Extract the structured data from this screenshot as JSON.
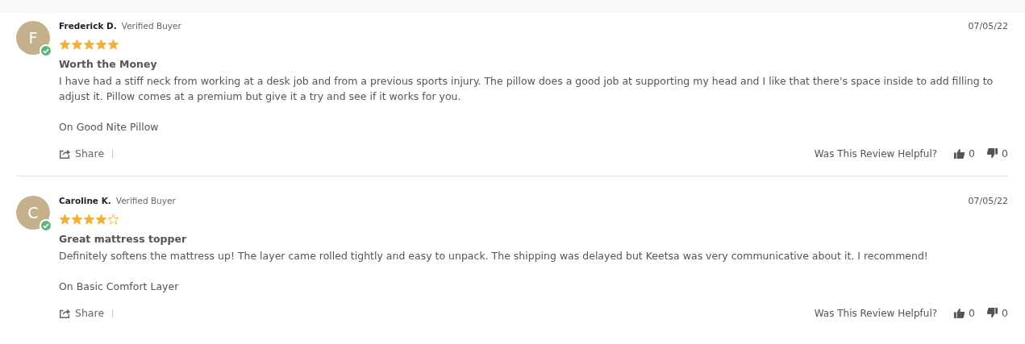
{
  "reviews": [
    {
      "initial": "F",
      "verified": true,
      "name": "Frederick D.",
      "badge": "Verified Buyer",
      "date": "07/05/22",
      "stars": 5,
      "title": "Worth the Money",
      "body": "I have had a stiff neck from working at a desk job and from a previous sports injury. The pillow does a good job at supporting my head and I like that there's space inside to add filling to adjust it. Pillow comes at a premium but give it a try and see if it works for you.",
      "product": "On Good Nite Pillow",
      "share": "Share",
      "helpful_prompt": "Was This Review Helpful?",
      "upvotes": "0",
      "downvotes": "0"
    },
    {
      "initial": "C",
      "verified": true,
      "name": "Caroline K.",
      "badge": "Verified Buyer",
      "date": "07/05/22",
      "stars": 4,
      "title": "Great mattress topper",
      "body": "Definitely softens the mattress up! The layer came rolled tightly and easy to unpack. The shipping was delayed but Keetsa was very communicative about it. I recommend!",
      "product": "On Basic Comfort Layer",
      "share": "Share",
      "helpful_prompt": "Was This Review Helpful?",
      "upvotes": "0",
      "downvotes": "0"
    }
  ]
}
